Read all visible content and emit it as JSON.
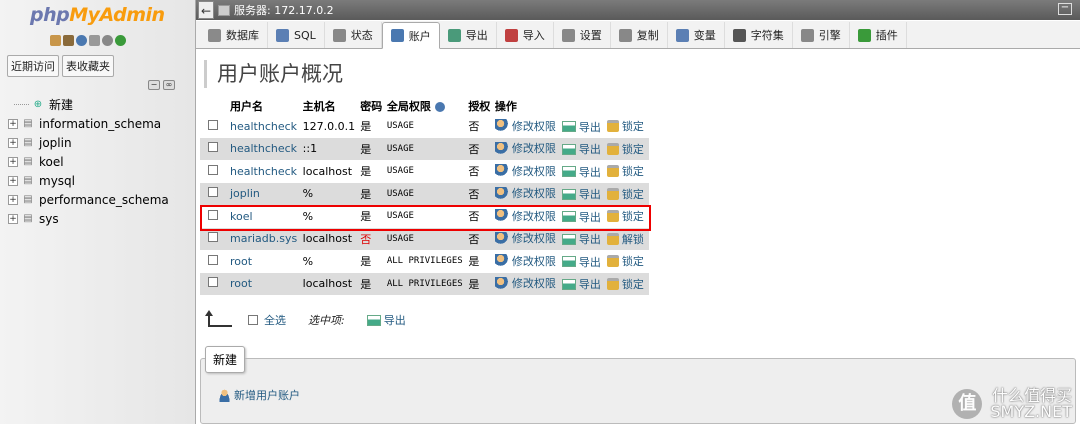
{
  "nav": {
    "logo_php": "php",
    "logo_myadmin": "MyAdmin",
    "tabs": [
      "近期访问",
      "表收藏夹"
    ],
    "tree": [
      "新建",
      "information_schema",
      "joplin",
      "koel",
      "mysql",
      "performance_schema",
      "sys"
    ]
  },
  "topbar": {
    "server": "服务器: 172.17.0.2"
  },
  "menu": [
    {
      "label": "数据库",
      "icon": "database-icon",
      "color": "#8a8a8a"
    },
    {
      "label": "SQL",
      "icon": "sql-icon",
      "color": "#5b7fb4"
    },
    {
      "label": "状态",
      "icon": "status-icon",
      "color": "#888"
    },
    {
      "label": "账户",
      "icon": "accounts-icon",
      "color": "#4a78b0"
    },
    {
      "label": "导出",
      "icon": "export-icon",
      "color": "#4a9a7a"
    },
    {
      "label": "导入",
      "icon": "import-icon",
      "color": "#c04040"
    },
    {
      "label": "设置",
      "icon": "wrench-icon",
      "color": "#888"
    },
    {
      "label": "复制",
      "icon": "replication-icon",
      "color": "#888"
    },
    {
      "label": "变量",
      "icon": "variables-icon",
      "color": "#5b7fb4"
    },
    {
      "label": "字符集",
      "icon": "charset-icon",
      "color": "#555"
    },
    {
      "label": "引擎",
      "icon": "engine-icon",
      "color": "#888"
    },
    {
      "label": "插件",
      "icon": "plugin-icon",
      "color": "#3a9a3a"
    }
  ],
  "page_title": "用户账户概况",
  "table": {
    "headers": [
      "用户名",
      "主机名",
      "密码",
      "全局权限",
      "授权",
      "操作"
    ],
    "rows": [
      {
        "user": "healthcheck",
        "host": "127.0.0.1",
        "password": "是",
        "privileges": "USAGE",
        "grant": "否",
        "lock": "锁定"
      },
      {
        "user": "healthcheck",
        "host": "::1",
        "password": "是",
        "privileges": "USAGE",
        "grant": "否",
        "lock": "锁定"
      },
      {
        "user": "healthcheck",
        "host": "localhost",
        "password": "是",
        "privileges": "USAGE",
        "grant": "否",
        "lock": "锁定"
      },
      {
        "user": "joplin",
        "host": "%",
        "password": "是",
        "privileges": "USAGE",
        "grant": "否",
        "lock": "锁定"
      },
      {
        "user": "koel",
        "host": "%",
        "password": "是",
        "privileges": "USAGE",
        "grant": "否",
        "lock": "锁定"
      },
      {
        "user": "mariadb.sys",
        "host": "localhost",
        "password": "否",
        "privileges": "USAGE",
        "grant": "否",
        "lock": "解锁"
      },
      {
        "user": "root",
        "host": "%",
        "password": "是",
        "privileges": "ALL PRIVILEGES",
        "grant": "是",
        "lock": "锁定"
      },
      {
        "user": "root",
        "host": "localhost",
        "password": "是",
        "privileges": "ALL PRIVILEGES",
        "grant": "是",
        "lock": "锁定"
      }
    ],
    "edit_label": "修改权限",
    "export_label": "导出"
  },
  "footer": {
    "select_all": "全选",
    "with_selected": "选中项:",
    "export": "导出"
  },
  "new_section": {
    "legend": "新建",
    "add_user": "新增用户账户"
  },
  "watermark": {
    "mark": "值",
    "line1": "什么值得买",
    "line2": "SMYZ.NET"
  }
}
